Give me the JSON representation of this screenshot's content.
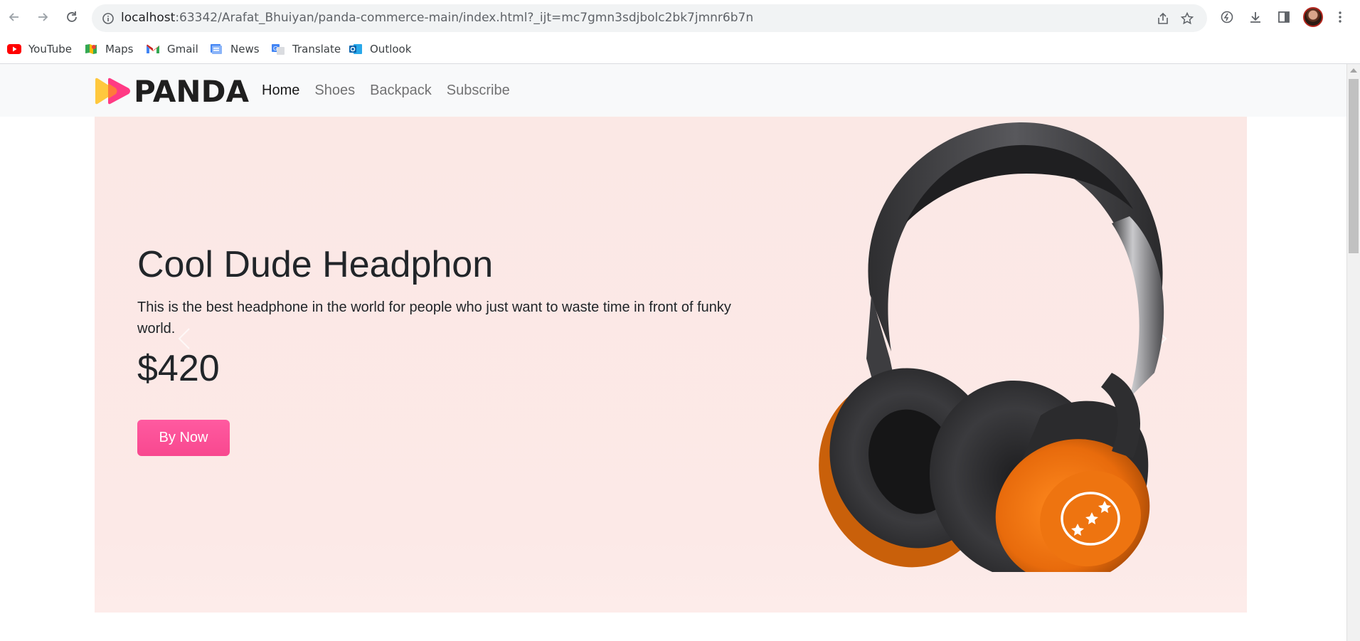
{
  "browser": {
    "url_host": "localhost",
    "url_rest": ":63342/Arafat_Bhuiyan/panda-commerce-main/index.html?_ijt=mc7gmn3sdjbolc2bk7jmnr6b7n",
    "icons": {
      "back": "arrow-left-icon",
      "forward": "arrow-right-icon",
      "reload": "reload-icon",
      "site_info": "info-icon",
      "share": "share-icon",
      "bookmark": "star-icon",
      "extensions": "extension-icon",
      "downloads": "download-icon",
      "side_panel": "side-panel-icon",
      "menu": "kebab-menu-icon"
    }
  },
  "bookmarks": [
    {
      "label": "YouTube",
      "icon": "youtube-icon"
    },
    {
      "label": "Maps",
      "icon": "maps-icon"
    },
    {
      "label": "Gmail",
      "icon": "gmail-icon"
    },
    {
      "label": "News",
      "icon": "news-icon"
    },
    {
      "label": "Translate",
      "icon": "translate-icon"
    },
    {
      "label": "Outlook",
      "icon": "outlook-icon"
    }
  ],
  "site": {
    "brand": "PANDA",
    "nav": [
      {
        "label": "Home",
        "active": true
      },
      {
        "label": "Shoes",
        "active": false
      },
      {
        "label": "Backpack",
        "active": false
      },
      {
        "label": "Subscribe",
        "active": false
      }
    ],
    "hero": {
      "title": "Cool Dude Headphon",
      "description": "This is the best headphone in the world for people who just want to waste time in front of funky world.",
      "price": "$420",
      "button_label": "By Now",
      "image": "headphone-image"
    }
  },
  "colors": {
    "hero_background": "#fce9e7",
    "button": "#ff4f9a",
    "logo_yellow": "#ffc83d",
    "logo_pink": "#ff2f7d",
    "headphone_orange": "#f07a18"
  }
}
